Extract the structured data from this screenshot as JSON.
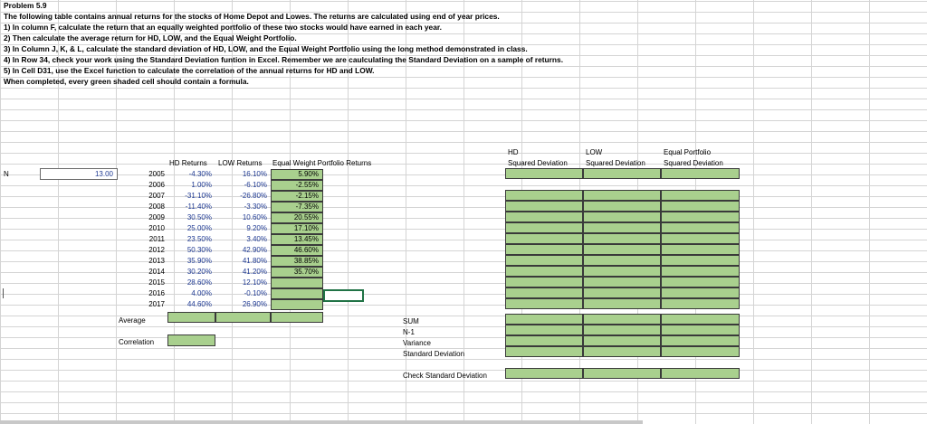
{
  "problem": {
    "title": "Problem 5.9",
    "lines": [
      "The following table contains annual returns for the stocks of Home Depot and Lowes.  The returns are calculated using end of year prices.",
      "1) In column F, calculate the return that an equally weighted portfolio of these two stocks would have earned in each year.",
      "2) Then calculate the average return for HD, LOW, and the Equal Weight Portfolio.",
      "3) In Column J, K, & L, calculate the standard deviation of HD, LOW, and the Equal Weight Portfolio using the long method demonstrated in class.",
      "4) In Row 34, check your work using the Standard Deviation funtion in Excel.  Remember we are caulculating the Standard Deviation on a sample of returns.",
      "5) In Cell D31, use the Excel function to calculate the correlation of the annual returns for HD and LOW.",
      "When completed, every green shaded cell should contain a formula."
    ]
  },
  "headers": {
    "hd_returns": "HD Returns",
    "low_returns": "LOW Returns",
    "eq_returns": "Equal Weight Portfolio Returns",
    "hd_sq_1": "HD",
    "hd_sq_2": "Squared Deviation",
    "low_sq_1": "LOW",
    "low_sq_2": "Squared Deviation",
    "eq_sq_1": "Equal Portfolio",
    "eq_sq_2": "Squared Deviation"
  },
  "n_label": "N",
  "n_value": "13.00",
  "rows": [
    {
      "year": "2005",
      "hd": "-4.30%",
      "low": "16.10%",
      "eq": "5.90%"
    },
    {
      "year": "2006",
      "hd": "1.00%",
      "low": "-6.10%",
      "eq": "-2.55%"
    },
    {
      "year": "2007",
      "hd": "-31.10%",
      "low": "-26.80%",
      "eq": "-2.15%"
    },
    {
      "year": "2008",
      "hd": "-11.40%",
      "low": "-3.30%",
      "eq": "-7.35%"
    },
    {
      "year": "2009",
      "hd": "30.50%",
      "low": "10.60%",
      "eq": "20.55%"
    },
    {
      "year": "2010",
      "hd": "25.00%",
      "low": "9.20%",
      "eq": "17.10%"
    },
    {
      "year": "2011",
      "hd": "23.50%",
      "low": "3.40%",
      "eq": "13.45%"
    },
    {
      "year": "2012",
      "hd": "50.30%",
      "low": "42.90%",
      "eq": "46.60%"
    },
    {
      "year": "2013",
      "hd": "35.90%",
      "low": "41.80%",
      "eq": "38.85%"
    },
    {
      "year": "2014",
      "hd": "30.20%",
      "low": "41.20%",
      "eq": "35.70%"
    },
    {
      "year": "2015",
      "hd": "28.60%",
      "low": "12.10%",
      "eq": ""
    },
    {
      "year": "2016",
      "hd": "4.00%",
      "low": "-0.10%",
      "eq": ""
    },
    {
      "year": "2017",
      "hd": "44.60%",
      "low": "26.90%",
      "eq": ""
    }
  ],
  "labels": {
    "average": "Average",
    "correlation": "Correlation",
    "sum": "SUM",
    "n_minus_1": "N-1",
    "variance": "Variance",
    "std_dev": "Standard Deviation",
    "check_std_dev": "Check Standard Deviation"
  },
  "colors": {
    "green_cell": "#a9d08e",
    "value_blue": "#1f3a93",
    "grid": "#d4d4d4",
    "selection": "#217346"
  }
}
